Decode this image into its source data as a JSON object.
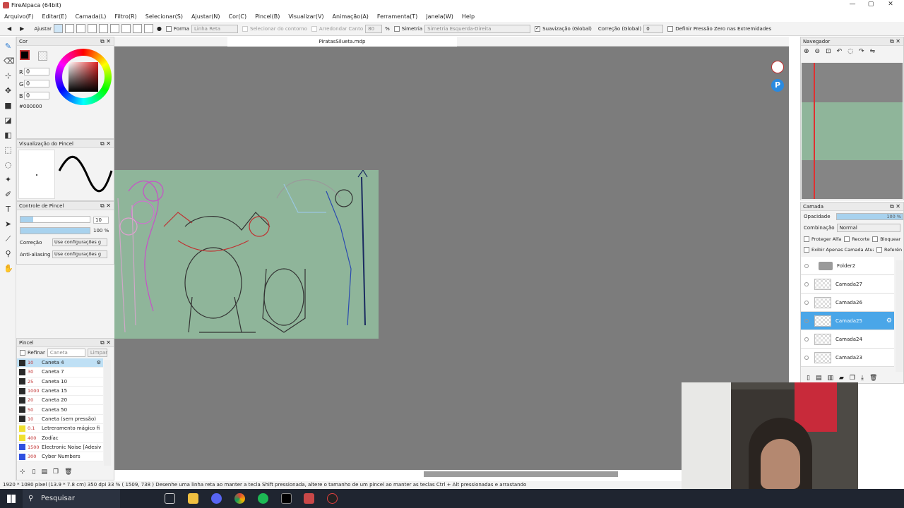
{
  "window": {
    "title": "FireAlpaca (64bit)"
  },
  "menu": [
    "Arquivo(F)",
    "Editar(E)",
    "Camada(L)",
    "Filtro(R)",
    "Selecionar(S)",
    "Ajustar(N)",
    "Cor(C)",
    "Pincel(B)",
    "Visualizar(V)",
    "Animação(A)",
    "Ferramenta(T)",
    "Janela(W)",
    "Help"
  ],
  "toolbar": {
    "ajustar": "Ajustar",
    "forma": "Forma",
    "forma_value": "Linha Reta",
    "selecionar_contorno": "Selecionar do contorno",
    "arredondar_canto": "Arredondar Canto",
    "arredondar_value": "80",
    "percent": "%",
    "simetria": "Simetria",
    "simetria_value": "Simetria Esquerda-Direita",
    "suavizacao": "Suavização (Global)",
    "correcao": "Correção (Global)",
    "correcao_value": "0",
    "pressao": "Definir Pressão Zero nas Extremidades"
  },
  "document_tab": "PiratasSilueta.mdp",
  "color_panel": {
    "title": "Cor",
    "r_label": "R",
    "r": "0",
    "g_label": "G",
    "g": "0",
    "b_label": "B",
    "b": "0",
    "hex": "#000000"
  },
  "brush_preview": {
    "title": "Visualização do Pincel"
  },
  "brush_control": {
    "title": "Controle de Pincel",
    "size": "10",
    "opacity": "100 %",
    "correcao_label": "Correção",
    "correcao_value": "Use configurações g",
    "antialias_label": "Anti-aliasing",
    "antialias_value": "Use configurações g"
  },
  "brush_panel": {
    "title": "Pincel",
    "refinar": "Refinar",
    "caneta": "Caneta",
    "limpar": "Limpar",
    "items": [
      {
        "size": "10",
        "name": "Caneta 4",
        "color": "#2a2a2a"
      },
      {
        "size": "30",
        "name": "Caneta 7",
        "color": "#2a2a2a"
      },
      {
        "size": "25",
        "name": "Caneta 10",
        "color": "#2a2a2a"
      },
      {
        "size": "1000",
        "name": "Caneta 15",
        "color": "#2a2a2a"
      },
      {
        "size": "20",
        "name": "Caneta 20",
        "color": "#2a2a2a"
      },
      {
        "size": "50",
        "name": "Caneta 50",
        "color": "#2a2a2a"
      },
      {
        "size": "10",
        "name": "Caneta (sem pressão)",
        "color": "#2a2a2a"
      },
      {
        "size": "0.1",
        "name": "Letreramento mágico fi",
        "color": "#f0e030"
      },
      {
        "size": "400",
        "name": "Zodíac",
        "color": "#f0e030"
      },
      {
        "size": "1500",
        "name": "Electronic Noise [Adesiv",
        "color": "#3050e0"
      },
      {
        "size": "300",
        "name": "Cyber Numbers",
        "color": "#3050e0"
      }
    ]
  },
  "navigator": {
    "title": "Navegador"
  },
  "layer_panel": {
    "title": "Camada",
    "opacity_label": "Opacidade",
    "opacity_value": "100 %",
    "blend_label": "Combinação",
    "blend_value": "Normal",
    "proteger": "Proteger Alfa",
    "recorte": "Recorte",
    "bloquear": "Bloquear",
    "exibir": "Exibir Apenas Camada Atual",
    "referencia": "Referên",
    "items": [
      {
        "name": "Folder2",
        "type": "folder"
      },
      {
        "name": "Camada27",
        "type": "layer"
      },
      {
        "name": "Camada26",
        "type": "layer"
      },
      {
        "name": "Camada25",
        "type": "layer",
        "selected": true
      },
      {
        "name": "Camada24",
        "type": "layer"
      },
      {
        "name": "Camada23",
        "type": "layer"
      }
    ]
  },
  "status": "1920 * 1080 pixel  (13.9 * 7.8 cm)  350 dpi  33 %  ( 1509, 738 )  Desenhe uma linha reta ao manter a tecla Shift pressionada, altere o tamanho de um pincel ao manter as teclas Ctrl + Alt pressionadas e arrastando",
  "taskbar": {
    "search": "Pesquisar"
  },
  "colors": {
    "accent": "#4aa6e8",
    "canvas_bg": "#7c7c7c",
    "drawing_bg": "#8fb59a"
  }
}
